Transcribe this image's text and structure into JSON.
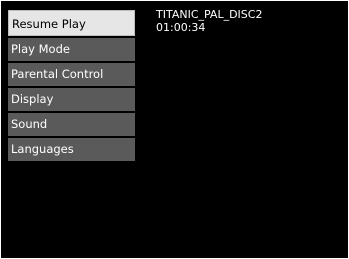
{
  "menu": {
    "items": [
      {
        "label": "Resume Play"
      },
      {
        "label": "Play Mode"
      },
      {
        "label": "Parental Control"
      },
      {
        "label": "Display"
      },
      {
        "label": "Sound"
      },
      {
        "label": "Languages"
      }
    ],
    "selected_index": 0
  },
  "disc": {
    "title": "TITANIC_PAL_DISC2",
    "time": "01:00:34"
  }
}
